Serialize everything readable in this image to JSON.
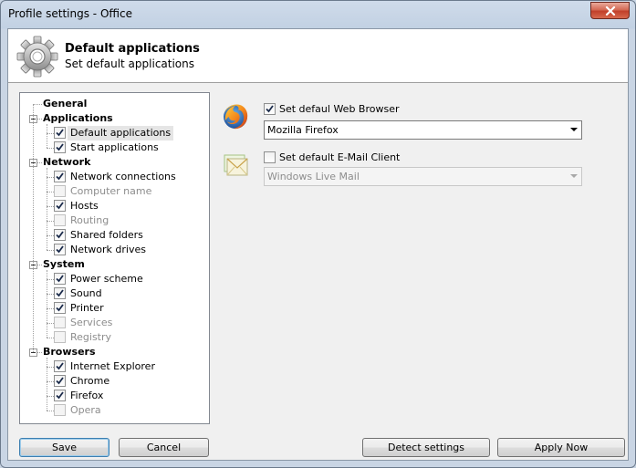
{
  "window": {
    "title": "Profile settings - Office"
  },
  "header": {
    "title": "Default applications",
    "subtitle": "Set default applications"
  },
  "tree": {
    "groups": [
      {
        "label": "General",
        "expandable": false,
        "items": []
      },
      {
        "label": "Applications",
        "expandable": true,
        "items": [
          {
            "label": "Default applications",
            "checked": true,
            "enabled": true,
            "selected": true
          },
          {
            "label": "Start applications",
            "checked": true,
            "enabled": true
          }
        ]
      },
      {
        "label": "Network",
        "expandable": true,
        "items": [
          {
            "label": "Network connections",
            "checked": true,
            "enabled": true
          },
          {
            "label": "Computer name",
            "checked": false,
            "enabled": false
          },
          {
            "label": "Hosts",
            "checked": true,
            "enabled": true
          },
          {
            "label": "Routing",
            "checked": false,
            "enabled": false
          },
          {
            "label": "Shared folders",
            "checked": true,
            "enabled": true
          },
          {
            "label": "Network drives",
            "checked": true,
            "enabled": true
          }
        ]
      },
      {
        "label": "System",
        "expandable": true,
        "items": [
          {
            "label": "Power scheme",
            "checked": true,
            "enabled": true
          },
          {
            "label": "Sound",
            "checked": true,
            "enabled": true
          },
          {
            "label": "Printer",
            "checked": true,
            "enabled": true
          },
          {
            "label": "Services",
            "checked": false,
            "enabled": false
          },
          {
            "label": "Registry",
            "checked": false,
            "enabled": false
          }
        ]
      },
      {
        "label": "Browsers",
        "expandable": true,
        "items": [
          {
            "label": "Internet Explorer",
            "checked": true,
            "enabled": true
          },
          {
            "label": "Chrome",
            "checked": true,
            "enabled": true
          },
          {
            "label": "Firefox",
            "checked": true,
            "enabled": true
          },
          {
            "label": "Opera",
            "checked": false,
            "enabled": false
          }
        ]
      }
    ]
  },
  "options": {
    "browser": {
      "icon": "firefox-icon",
      "checkbox_label": "Set defaul Web Browser",
      "checked": true,
      "selected": "Mozilla Firefox",
      "enabled": true
    },
    "email": {
      "icon": "mail-client-icon",
      "checkbox_label": "Set default E-Mail Client",
      "checked": false,
      "selected": "Windows Live Mail",
      "enabled": false
    }
  },
  "buttons": {
    "save": "Save",
    "cancel": "Cancel",
    "detect": "Detect settings",
    "apply": "Apply Now"
  }
}
